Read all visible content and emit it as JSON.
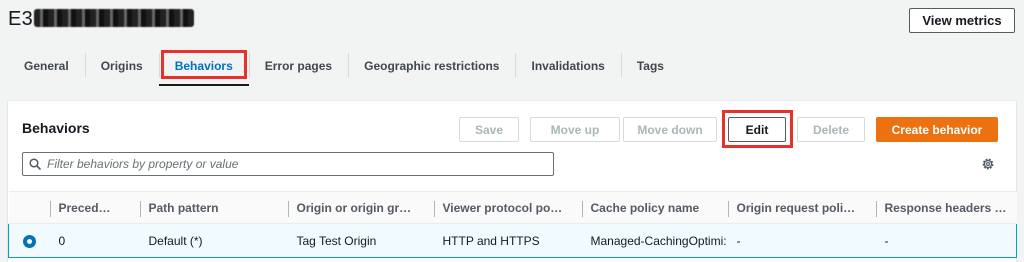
{
  "header": {
    "title_prefix": "E3",
    "view_metrics_label": "View metrics"
  },
  "tabs": [
    {
      "label": "General",
      "active": false
    },
    {
      "label": "Origins",
      "active": false
    },
    {
      "label": "Behaviors",
      "active": true
    },
    {
      "label": "Error pages",
      "active": false
    },
    {
      "label": "Geographic restrictions",
      "active": false
    },
    {
      "label": "Invalidations",
      "active": false
    },
    {
      "label": "Tags",
      "active": false
    }
  ],
  "behaviors_panel": {
    "title": "Behaviors",
    "buttons": {
      "save": "Save",
      "move_up": "Move up",
      "move_down": "Move down",
      "edit": "Edit",
      "delete": "Delete",
      "create": "Create behavior"
    },
    "search": {
      "placeholder": "Filter behaviors by property or value",
      "value": ""
    },
    "table": {
      "columns": [
        "",
        "Preced…",
        "Path pattern",
        "Origin or origin gr…",
        "Viewer protocol po…",
        "Cache policy name",
        "Origin request poli…",
        "Response headers …"
      ],
      "rows": [
        {
          "selected": true,
          "precedence": "0",
          "path_pattern": "Default (*)",
          "origin": "Tag Test Origin",
          "viewer_protocol": "HTTP and HTTPS",
          "cache_policy": "Managed-CachingOptimi:",
          "origin_request_policy": "-",
          "response_headers": "-"
        }
      ]
    }
  },
  "colors": {
    "accent_blue": "#0073bb",
    "primary_orange": "#ec7211",
    "highlight_red": "#e8312a",
    "selected_row_bg": "#f1faff"
  },
  "icons": {
    "search": "search-icon",
    "settings": "gear-icon",
    "radio": "radio-selected-icon"
  }
}
